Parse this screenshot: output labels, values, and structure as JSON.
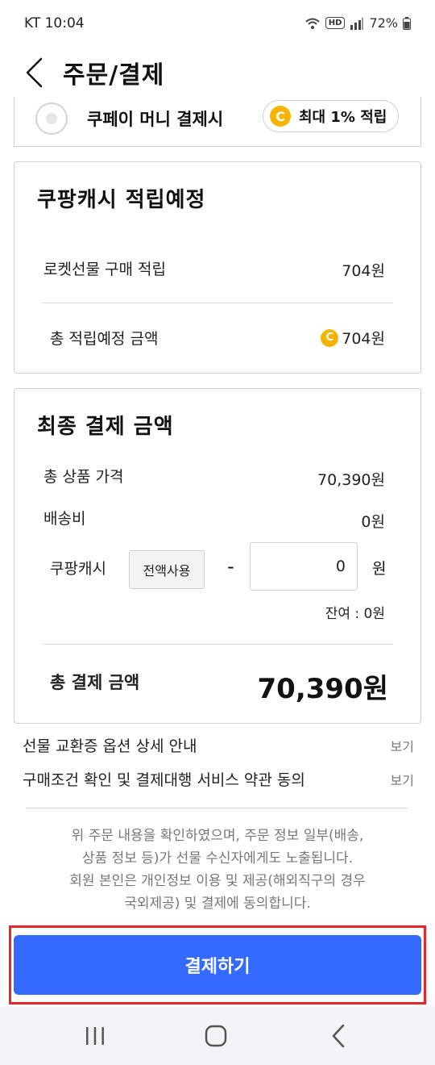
{
  "status_bar": {
    "carrier_time": "KT 10:04",
    "battery": "72%",
    "hd_badge": "HD"
  },
  "header": {
    "title": "주문/결제"
  },
  "coupay": {
    "label": "쿠페이 머니 결제시",
    "reward_icon": "C",
    "reward_text": "최대 1% 적립"
  },
  "cash_reward": {
    "title": "쿠팡캐시 적립예정",
    "rows": [
      {
        "label": "로켓선물 구매 적립",
        "value": "704원"
      },
      {
        "label": "총 적립예정 금액",
        "value": "704원",
        "coin": "C"
      }
    ]
  },
  "final_payment": {
    "title": "최종 결제 금액",
    "product_total_label": "총 상품 가격",
    "product_total_value": "70,390원",
    "shipping_label": "배송비",
    "shipping_value": "0원",
    "cash_label": "쿠팡캐시",
    "use_all_label": "전액사용",
    "minus": "-",
    "cash_input_value": "0",
    "cash_unit": "원",
    "balance": "잔여 : 0원",
    "total_label": "총 결제 금액",
    "total_value": "70,390원"
  },
  "links": [
    {
      "label": "선물 교환증 옵션 상세 안내",
      "action": "보기"
    },
    {
      "label": "구매조건 확인 및 결제대행 서비스 약관 동의",
      "action": "보기"
    }
  ],
  "notice": {
    "line1": "위 주문 내용을 확인하였으며, 주문 정보 일부(배송,",
    "line2": "상품 정보 등)가 선물 수신자에게도 노출됩니다.",
    "line3": "회원 본인은 개인정보 이용 및 제공(해외직구의 경우",
    "line4": "국외제공) 및 결제에 동의합니다."
  },
  "pay_button": {
    "label": "결제하기"
  },
  "colors": {
    "accent": "#346aff",
    "highlight": "#e8262a",
    "coin": "#f5b400"
  }
}
